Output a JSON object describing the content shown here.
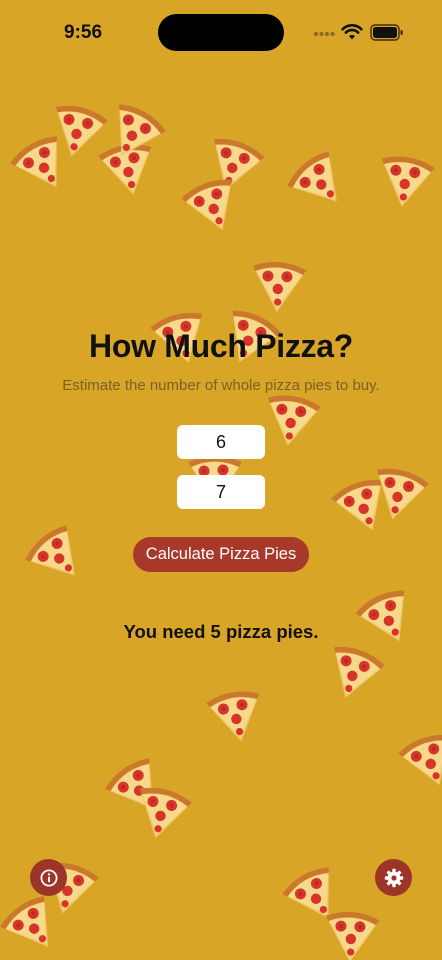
{
  "status_bar": {
    "time": "9:56"
  },
  "main": {
    "title": "How Much Pizza?",
    "subtitle": "Estimate the number of whole pizza pies to buy.",
    "people_field": {
      "value": "6"
    },
    "slices_field": {
      "value": "7"
    },
    "calculate_label": "Calculate Pizza Pies",
    "result_text": "You need 5 pizza pies."
  },
  "footer": {
    "info_icon": "info-icon",
    "settings_icon": "gear-icon"
  },
  "colors": {
    "background": "#d9a527",
    "accent_button": "#a8382a",
    "round_button": "#9c3527",
    "subtitle_text": "#7a6228"
  }
}
